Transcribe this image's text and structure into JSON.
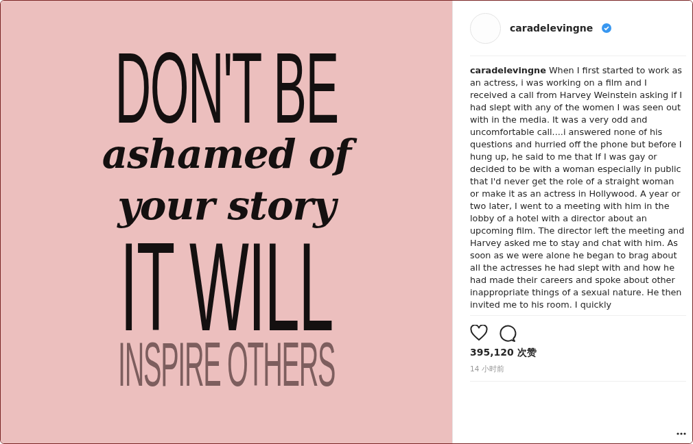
{
  "poster": {
    "lines": [
      {
        "text": "DON'T BE",
        "kind": "thin"
      },
      {
        "text": "ashamed of",
        "kind": "script"
      },
      {
        "text": "your story",
        "kind": "script"
      },
      {
        "text": "IT WILL",
        "kind": "tall"
      },
      {
        "text": "INSPIRE OTHERS",
        "kind": "faded"
      }
    ]
  },
  "post": {
    "username": "caradelevingne",
    "verified": true,
    "caption": "**caradelevingne** When I first started to work as an actress, i was working on a film and I received a call from Harvey Weinstein asking if I had slept with any of the women I was seen out with in the media. It was a very odd and uncomfortable call....i answered none of his questions and hurried off the phone but before I hung up, he said to me that If I was gay or decided to be with a woman especially in public that I'd never get the role of a straight woman or make it as an actress in Hollywood. A year or two later, I went to a meeting with him in the lobby of a hotel with a director about an upcoming film. The director left the meeting and Harvey asked me to stay and chat with him. As soon as we were alone he began to brag about all the actresses he had slept with and how he had made their careers and spoke about other inappropriate things of a sexual nature. He then invited me to his room. I quickly",
    "liked": false,
    "likes": "395,120 次赞",
    "time": "14 小时前"
  }
}
